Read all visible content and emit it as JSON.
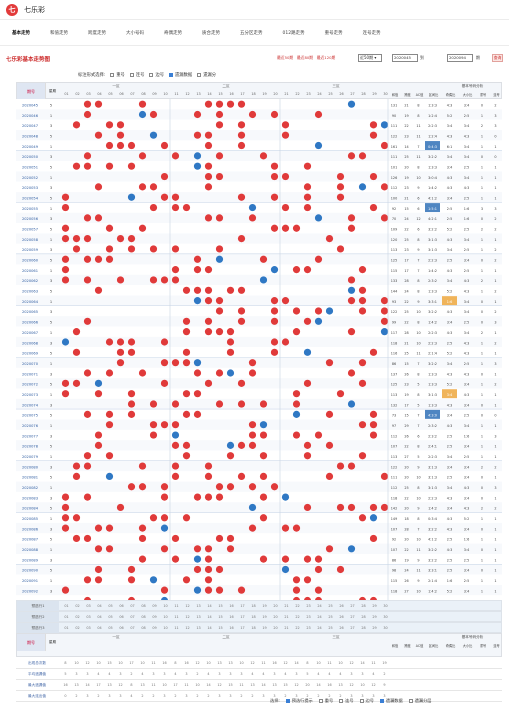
{
  "app": {
    "title": "七乐彩"
  },
  "nav": [
    {
      "label": "基本走势",
      "active": true
    },
    {
      "label": "和值走势",
      "active": false
    },
    {
      "label": "跨度走势",
      "active": false
    },
    {
      "label": "大小号码",
      "active": false
    },
    {
      "label": "奇偶走势",
      "active": false
    },
    {
      "label": "质合走势",
      "active": false
    },
    {
      "label": "五分区走势",
      "active": false
    },
    {
      "label": "012路走势",
      "active": false
    },
    {
      "label": "重号走势",
      "active": false
    },
    {
      "label": "连号走势",
      "active": false
    }
  ],
  "toolbar": {
    "title": "七乐彩基本走势图",
    "stat1": "最近50期",
    "stat2": "最近80期",
    "stat3": "最近120期",
    "period_select": "近50期",
    "date_from": "2020045",
    "to": "到",
    "date_to": "2020094",
    "period_unit": "期",
    "query": "查询"
  },
  "options": {
    "label": "标注形式选择:",
    "items": [
      {
        "label": "重号",
        "checked": false
      },
      {
        "label": "连号",
        "checked": false
      },
      {
        "label": "边号",
        "checked": false
      },
      {
        "label": "遗漏数据",
        "checked": true
      },
      {
        "label": "遗漏分",
        "checked": false
      }
    ]
  },
  "table": {
    "header": {
      "issue": "期号",
      "col2": "星期",
      "zone1": "一区",
      "zone2": "二区",
      "zone3": "三区",
      "numbers": [
        "01",
        "02",
        "03",
        "04",
        "05",
        "06",
        "07",
        "08",
        "09",
        "10",
        "11",
        "12",
        "13",
        "14",
        "15",
        "16",
        "17",
        "18",
        "19",
        "20",
        "21",
        "22",
        "23",
        "24",
        "25",
        "26",
        "27",
        "28",
        "29",
        "30"
      ],
      "extra": [
        "和值",
        "跨度",
        "AC值",
        "区间比",
        "奇偶比",
        "大小比",
        "重号",
        "连号"
      ],
      "dist_title": "基本号码分析"
    },
    "issues": [
      "2020045",
      "2020046",
      "2020047",
      "2020048",
      "2020049",
      "2020050",
      "2020051",
      "2020052",
      "2020053",
      "2020054",
      "2020055",
      "2020056",
      "2020057",
      "2020058",
      "2020059",
      "2020060",
      "2020061",
      "2020062",
      "2020063",
      "2020064",
      "2020065",
      "2020066",
      "2020067",
      "2020068",
      "2020069",
      "2020070",
      "2020071",
      "2020072",
      "2020073",
      "2020074",
      "2020075",
      "2020076",
      "2020077",
      "2020078",
      "2020079",
      "2020080",
      "2020081",
      "2020082",
      "2020083",
      "2020084",
      "2020085",
      "2020086",
      "2020087",
      "2020088",
      "2020089",
      "2020090",
      "2020091",
      "2020092",
      "2020093",
      "2020094"
    ],
    "weekday": [
      "5",
      "1",
      "3",
      "5",
      "1",
      "3",
      "5",
      "1",
      "3",
      "5",
      "1",
      "3",
      "5",
      "1",
      "3",
      "5",
      "1",
      "3",
      "5",
      "1",
      "3",
      "5",
      "1",
      "3",
      "5",
      "1",
      "3",
      "5",
      "1",
      "3",
      "5",
      "1",
      "3",
      "5",
      "1",
      "3",
      "5",
      "1",
      "3",
      "5",
      "1",
      "3",
      "5",
      "1",
      "3",
      "5",
      "1",
      "3",
      "5",
      "1"
    ],
    "sum": [
      "131",
      "90",
      "111",
      "122",
      "161",
      "111",
      "101",
      "126",
      "112",
      "100",
      "92",
      "70",
      "109",
      "120",
      "113",
      "125",
      "115",
      "133",
      "144",
      "93",
      "122",
      "99",
      "117",
      "118",
      "116",
      "86",
      "137",
      "125",
      "113",
      "132",
      "73",
      "97",
      "112",
      "107",
      "113",
      "122",
      "111",
      "112",
      "118",
      "142",
      "149",
      "107",
      "92",
      "107",
      "86",
      "98",
      "115",
      "118",
      "120",
      "96"
    ],
    "span": [
      "21",
      "19",
      "22",
      "23",
      "14",
      "25",
      "20",
      "19",
      "23",
      "21",
      "15",
      "24",
      "22",
      "25",
      "23",
      "17",
      "17",
      "28",
      "24",
      "22",
      "25",
      "22",
      "28",
      "21",
      "25",
      "15",
      "26",
      "23",
      "19",
      "17",
      "15",
      "29",
      "26",
      "22",
      "27",
      "20",
      "20",
      "25",
      "22",
      "20",
      "18",
      "28",
      "20",
      "22",
      "19",
      "24",
      "26",
      "27",
      "25",
      "21"
    ],
    "ac": [
      "8",
      "8",
      "11",
      "11",
      "7",
      "11",
      "8",
      "10",
      "9",
      "6",
      "6",
      "12",
      "6",
      "8",
      "9",
      "7",
      "7",
      "8",
      "8",
      "9",
      "10",
      "8",
      "10",
      "10",
      "11",
      "7",
      "8",
      "5",
      "8",
      "5",
      "7",
      "7",
      "6",
      "8",
      "5",
      "9",
      "10",
      "8",
      "10",
      "9",
      "8",
      "7",
      "10",
      "11",
      "9",
      "11",
      "9",
      "10",
      "10",
      "6"
    ],
    "ratio": [
      "1:3:3",
      "1:2:4",
      "2:2:3",
      "1:2:4",
      "0:4:3",
      "3:2:2",
      "1:3:3",
      "3:0:4",
      "1:4:2",
      "4:1:2",
      "1:5:1",
      "4:2:1",
      "3:2:2",
      "3:1:3",
      "3:1:3",
      "2:2:3",
      "1:4:2",
      "2:3:2",
      "1:3:3",
      "3:3:1",
      "3:2:2",
      "1:4:2",
      "2:2:3",
      "2:2:3",
      "2:1:4",
      "3:2:2",
      "1:3:3",
      "1:3:3",
      "3:1:3",
      "1:3:3",
      "4:3:0",
      "2:3:2",
      "2:3:2",
      "2:4:1",
      "2:2:3",
      "3:1:3",
      "3:1:3",
      "3:1:3",
      "2:2:3",
      "1:4:2",
      "0:3:4",
      "3:2:2",
      "4:1:2",
      "3:2:2",
      "3:2:2",
      "3:3:1",
      "2:1:4",
      "1:4:2",
      "3:1:3",
      "3:2:2"
    ],
    "odd": [
      "4:3",
      "5:2",
      "3:4",
      "4:3",
      "6:1",
      "3:4",
      "3:4",
      "4:3",
      "4:3",
      "3:4",
      "2:5",
      "2:5",
      "5:2",
      "4:3",
      "3:4",
      "2:5",
      "4:3",
      "3:4",
      "5:2",
      "1:6",
      "4:3",
      "3:4",
      "4:3",
      "2:5",
      "5:2",
      "3:4",
      "4:3",
      "5:2",
      "3:4",
      "4:3",
      "3:4",
      "4:3",
      "2:5",
      "2:5",
      "3:4",
      "3:4",
      "2:5",
      "3:4",
      "4:3",
      "3:4",
      "4:3",
      "4:3",
      "2:5",
      "4:3",
      "2:5",
      "2:5",
      "1:6",
      "5:2",
      "5:2",
      "4:3"
    ],
    "big": [
      "3:4",
      "2:5",
      "3:4",
      "4:3",
      "3:4",
      "3:4",
      "2:5",
      "3:4",
      "4:3",
      "2:5",
      "1:6",
      "1:6",
      "2:5",
      "3:4",
      "2:5",
      "3:4",
      "2:5",
      "4:3",
      "4:3",
      "3:4",
      "3:4",
      "2:5",
      "3:4",
      "4:3",
      "4:3",
      "2:5",
      "4:3",
      "3:4",
      "4:3",
      "3:4",
      "2:5",
      "3:4",
      "1:6",
      "3:4",
      "2:5",
      "3:4",
      "3:4",
      "4:3",
      "3:4",
      "4:3",
      "5:2",
      "3:4",
      "1:6",
      "3:4",
      "2:5",
      "3:4",
      "2:5",
      "3:4",
      "4:3",
      "2:5"
    ],
    "repeat": [
      "0",
      "1",
      "2",
      "1",
      "1",
      "0",
      "1",
      "1",
      "1",
      "1",
      "3",
      "0",
      "2",
      "1",
      "1",
      "0",
      "1",
      "2",
      "1",
      "0",
      "0",
      "0",
      "2",
      "1",
      "1",
      "1",
      "0",
      "1",
      "1",
      "0",
      "0",
      "1",
      "1",
      "1",
      "1",
      "2",
      "0",
      "0",
      "0",
      "2",
      "1",
      "0",
      "1",
      "0",
      "1",
      "0",
      "1",
      "1",
      "1",
      "0"
    ],
    "consec": [
      "2",
      "3",
      "3",
      "0",
      "1",
      "0",
      "1",
      "1",
      "1",
      "1",
      "3",
      "2",
      "2",
      "1",
      "2",
      "2",
      "1",
      "1",
      "2",
      "1",
      "2",
      "3",
      "1",
      "2",
      "1",
      "3",
      "1",
      "2",
      "1",
      "1",
      "0",
      "1",
      "3",
      "1",
      "1",
      "2",
      "1",
      "3",
      "1",
      "2",
      "1",
      "1",
      "1",
      "1",
      "1",
      "1",
      "1",
      "1",
      "2",
      "3"
    ],
    "predict": [
      {
        "label": "预选行1"
      },
      {
        "label": "预选行2"
      },
      {
        "label": "预选行3"
      }
    ],
    "footer_header": {
      "issue": "期号",
      "col2": "星期",
      "zone1": "一区",
      "zone2": "二区",
      "zone3": "三区",
      "extra": [
        "和值",
        "跨度",
        "AC值",
        "区间比",
        "奇偶比",
        "大小比",
        "重号",
        "连号"
      ],
      "dist_title": "基本号码分析"
    },
    "stats": [
      {
        "label": "出现总次数",
        "values": [
          "8",
          "10",
          "12",
          "10",
          "15",
          "10",
          "17",
          "10",
          "11",
          "16",
          "8",
          "16",
          "12",
          "10",
          "13",
          "13",
          "10",
          "12",
          "11",
          "16",
          "12",
          "14",
          "8",
          "10",
          "11",
          "10",
          "12",
          "14",
          "11",
          "19"
        ]
      },
      {
        "label": "平均遗漏值",
        "values": [
          "5",
          "3",
          "3",
          "4",
          "4",
          "3",
          "2",
          "4",
          "3",
          "3",
          "4",
          "3",
          "2",
          "4",
          "3",
          "3",
          "3",
          "4",
          "4",
          "3",
          "4",
          "3",
          "5",
          "4",
          "4",
          "4",
          "3",
          "3",
          "4",
          "2"
        ]
      },
      {
        "label": "最大遗漏值",
        "values": [
          "16",
          "13",
          "14",
          "17",
          "13",
          "12",
          "8",
          "13",
          "11",
          "10",
          "17",
          "11",
          "10",
          "14",
          "12",
          "15",
          "11",
          "13",
          "14",
          "13",
          "15",
          "12",
          "20",
          "14",
          "16",
          "13",
          "12",
          "10",
          "12",
          "9"
        ]
      },
      {
        "label": "最大连出值",
        "values": [
          "0",
          "2",
          "3",
          "2",
          "3",
          "3",
          "4",
          "2",
          "2",
          "3",
          "2",
          "3",
          "2",
          "2",
          "3",
          "3",
          "2",
          "2",
          "3",
          "3",
          "2",
          "3",
          "2",
          "2",
          "2",
          "2",
          "3",
          "3",
          "3",
          "3"
        ]
      }
    ]
  },
  "legend": {
    "label": "选择:",
    "items": [
      {
        "label": "预选行提示",
        "checked": true
      },
      {
        "label": "重号",
        "checked": false
      },
      {
        "label": "连号",
        "checked": false
      },
      {
        "label": "边号",
        "checked": false
      },
      {
        "label": "遗漏数据",
        "checked": true
      },
      {
        "label": "遗漏分层",
        "checked": false
      }
    ]
  },
  "colors": {
    "red_ball": "#e03a3a",
    "blue_ball": "#2f78c4",
    "accent": "#cc2a2a",
    "header_bg": "#dfe6f2",
    "band": "#eaf1f8"
  }
}
